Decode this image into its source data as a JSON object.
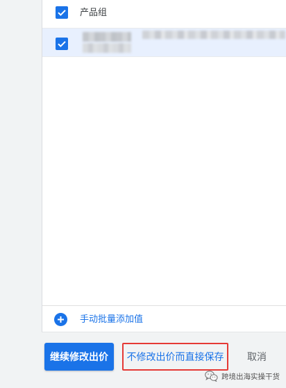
{
  "theme": {
    "accent": "#1a73e8",
    "selected_row": "#e8f0fe",
    "annotation": "#e53935",
    "page_background": "#f1f3f4"
  },
  "list": {
    "checkbox_icon": "checkbox-checked-icon",
    "rows": [
      {
        "label": "产品组",
        "checked": true,
        "selected": false
      },
      {
        "checked": true,
        "selected": true
      }
    ]
  },
  "add_values": {
    "icon": "add-circle-icon",
    "label": "手动批量添加值"
  },
  "footer": {
    "continue_edit_bid_label": "继续修改出价",
    "save_without_bid_change_label": "不修改出价而直接保存",
    "cancel_label": "取消"
  },
  "watermark": {
    "icon": "wechat-icon",
    "text": "跨境出海实操干货"
  }
}
